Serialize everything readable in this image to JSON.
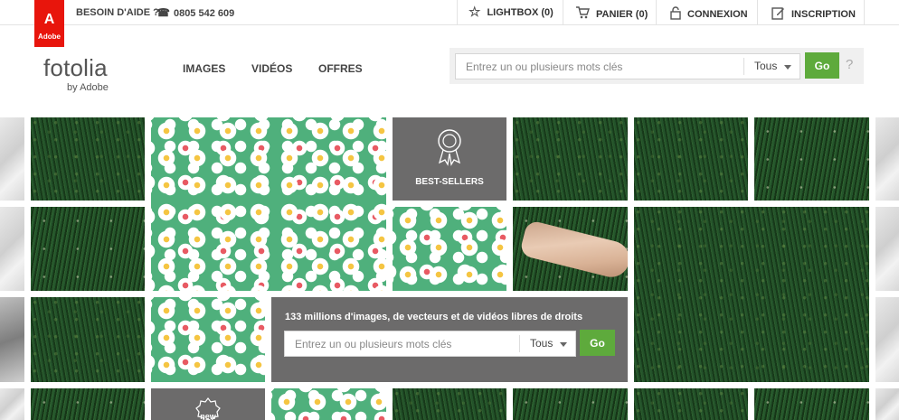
{
  "brand": {
    "adobe_mark": "A",
    "adobe_label": "Adobe",
    "name": "fotolia",
    "byline": "by Adobe"
  },
  "topbar": {
    "help_label": "BESOIN D'AIDE ?",
    "phone": "0805 542 609",
    "lightbox": "LIGHTBOX (0)",
    "cart": "PANIER (0)",
    "login": "CONNEXION",
    "signup": "INSCRIPTION"
  },
  "nav": {
    "images": "IMAGES",
    "videos": "VIDÉOS",
    "offers": "OFFRES"
  },
  "search": {
    "placeholder": "Entrez un ou plusieurs mots clés",
    "filter_value": "Tous",
    "go_label": "Go",
    "help": "?"
  },
  "mosaic": {
    "bestsellers_label": "BEST-SELLERS",
    "new_label": "new"
  },
  "promo": {
    "headline": "133 millions d'images, de vecteurs et de vidéos libres de droits",
    "placeholder": "Entrez un ou plusieurs mots clés",
    "filter_value": "Tous",
    "go_label": "Go"
  },
  "colors": {
    "adobe_red": "#e8150c",
    "go_green": "#5eaa3c",
    "card_gray": "#6c6b6b"
  }
}
